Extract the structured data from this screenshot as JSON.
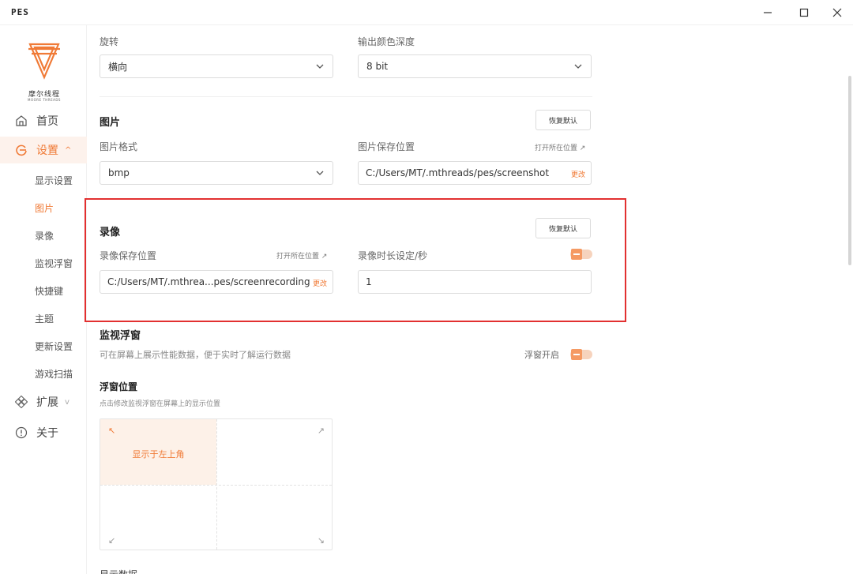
{
  "window": {
    "title": "PES",
    "minimize_glyph": "—",
    "maximize_glyph": "☐",
    "close_glyph": "✕"
  },
  "sidebar": {
    "logo_cn": "摩尔线程",
    "logo_en": "MOORE THREADS",
    "nav": [
      {
        "label": "首页",
        "icon": "home-icon"
      },
      {
        "label": "设置",
        "icon": "settings-icon",
        "active": true
      },
      {
        "label": "扩展",
        "icon": "extension-icon"
      },
      {
        "label": "关于",
        "icon": "info-icon"
      }
    ],
    "sub_items": [
      "显示设置",
      "图片",
      "录像",
      "监视浮窗",
      "快捷键",
      "主题",
      "更新设置",
      "游戏扫描"
    ],
    "active_sub": "图片",
    "accent": "#f07a36"
  },
  "display": {
    "rotation_label": "旋转",
    "rotation_value": "横向",
    "color_depth_label": "输出颜色深度",
    "color_depth_value": "8 bit"
  },
  "picture": {
    "title": "图片",
    "reset_label": "恢复默认",
    "format_label": "图片格式",
    "format_value": "bmp",
    "save_location_label": "图片保存位置",
    "open_location_label": "打开所在位置 ↗",
    "save_path": "C:/Users/MT/.mthreads/pes/screenshot",
    "change_label": "更改"
  },
  "recording": {
    "title": "录像",
    "reset_label": "恢复默认",
    "save_location_label": "录像保存位置",
    "open_location_label": "打开所在位置 ↗",
    "save_path": "C:/Users/MT/.mthrea...pes/screenrecording",
    "change_label": "更改",
    "duration_label": "录像时长设定/秒",
    "duration_value": "1",
    "duration_toggle_on": false
  },
  "overlay": {
    "title": "监视浮窗",
    "description": "可在屏幕上展示性能数据，便于实时了解运行数据",
    "toggle_label": "浮窗开启",
    "toggle_on": false,
    "position_title": "浮窗位置",
    "position_hint": "点击修改监视浮窗在屏幕上的显示位置",
    "position_selected_text": "显示于左上角",
    "arrows": {
      "top_left": "↖",
      "top_right": "↗",
      "bottom_left": "↙",
      "bottom_right": "↘"
    }
  },
  "footer_cut_text": "显示数据"
}
